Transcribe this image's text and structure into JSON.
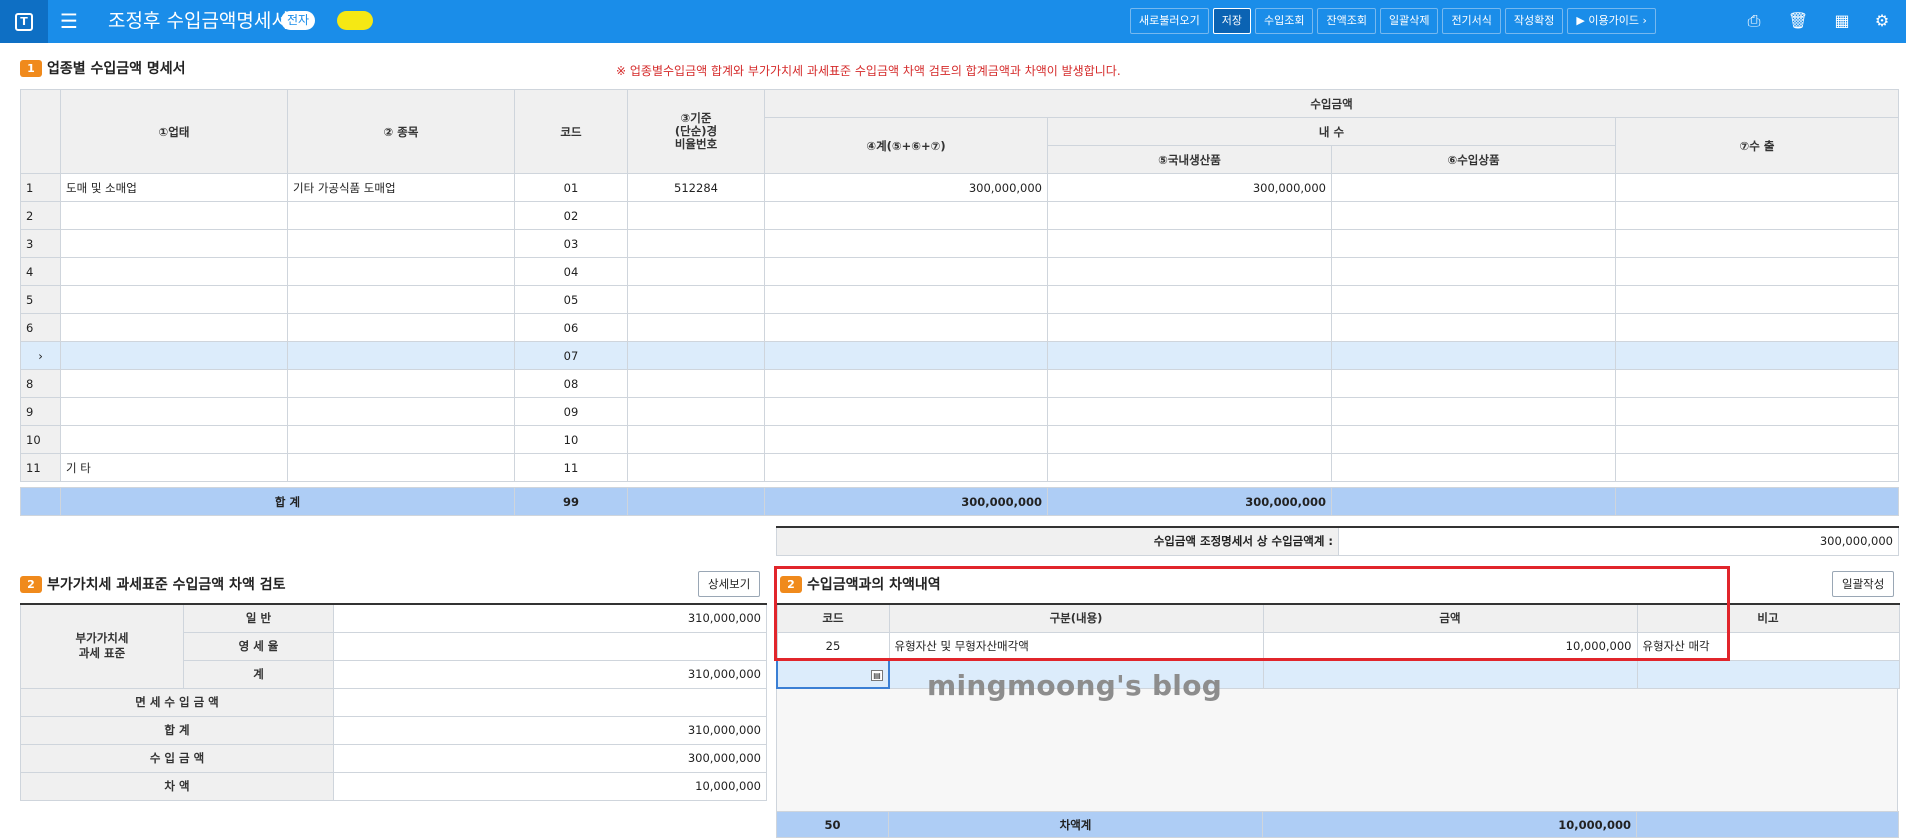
{
  "header": {
    "logo": "T",
    "title": "조정후 수입금액명세서",
    "badge": "전자",
    "buttons": [
      "새로불러오기",
      "저장",
      "수입조회",
      "잔액조회",
      "일괄삭제",
      "전기서식",
      "작성확정",
      "이용가이드 ›"
    ],
    "icons": [
      "menu-icon",
      "printer-icon",
      "trash-icon",
      "calculator-icon",
      "settings-icon"
    ]
  },
  "section1": {
    "num": "1",
    "title": "업종별 수입금액 명세서",
    "warning": "※ 업종별수입금액 합계와 부가가치세 과세표준 수입금액 차액 검토의 합계금액과 차액이 발생합니다.",
    "headers": {
      "upte": "①업태",
      "jongmok": "② 종목",
      "code": "코드",
      "rate1": "③기준",
      "rate2": "(단순)경",
      "rate3": "비율번호",
      "income": "수입금액",
      "gye": "④계(⑤+⑥+⑦)",
      "domestic": "내 수",
      "prod": "⑤국내생산품",
      "imp": "⑥수입상품",
      "export": "⑦수 출"
    },
    "rows": [
      {
        "no": "1",
        "upte": "도매 및 소매업",
        "jongmok": "기타 가공식품 도매업",
        "code": "01",
        "rate": "512284",
        "gye": "300,000,000",
        "prod": "300,000,000",
        "imp": "",
        "export": ""
      },
      {
        "no": "2",
        "upte": "",
        "jongmok": "",
        "code": "02",
        "rate": "",
        "gye": "",
        "prod": "",
        "imp": "",
        "export": ""
      },
      {
        "no": "3",
        "upte": "",
        "jongmok": "",
        "code": "03",
        "rate": "",
        "gye": "",
        "prod": "",
        "imp": "",
        "export": ""
      },
      {
        "no": "4",
        "upte": "",
        "jongmok": "",
        "code": "04",
        "rate": "",
        "gye": "",
        "prod": "",
        "imp": "",
        "export": ""
      },
      {
        "no": "5",
        "upte": "",
        "jongmok": "",
        "code": "05",
        "rate": "",
        "gye": "",
        "prod": "",
        "imp": "",
        "export": ""
      },
      {
        "no": "6",
        "upte": "",
        "jongmok": "",
        "code": "06",
        "rate": "",
        "gye": "",
        "prod": "",
        "imp": "",
        "export": ""
      },
      {
        "no": "›",
        "upte": "",
        "jongmok": "",
        "code": "07",
        "rate": "",
        "gye": "",
        "prod": "",
        "imp": "",
        "export": ""
      },
      {
        "no": "8",
        "upte": "",
        "jongmok": "",
        "code": "08",
        "rate": "",
        "gye": "",
        "prod": "",
        "imp": "",
        "export": ""
      },
      {
        "no": "9",
        "upte": "",
        "jongmok": "",
        "code": "09",
        "rate": "",
        "gye": "",
        "prod": "",
        "imp": "",
        "export": ""
      },
      {
        "no": "10",
        "upte": "",
        "jongmok": "",
        "code": "10",
        "rate": "",
        "gye": "",
        "prod": "",
        "imp": "",
        "export": ""
      },
      {
        "no": "11",
        "upte": "기  타",
        "jongmok": "",
        "code": "11",
        "rate": "",
        "gye": "",
        "prod": "",
        "imp": "",
        "export": ""
      }
    ],
    "sum": {
      "label": "합      계",
      "code": "99",
      "gye": "300,000,000",
      "prod": "300,000,000"
    },
    "adjust": {
      "label": "수입금액 조정명세서 상 수입금액계 :",
      "value": "300,000,000"
    }
  },
  "section2a": {
    "num": "2",
    "title": "부가가치세 과세표준 수입금액 차액 검토",
    "detail_button": "상세보기",
    "group_label1": "부가가치세",
    "group_label2": "과세 표준",
    "rows": [
      {
        "label": "일  반",
        "value": "310,000,000"
      },
      {
        "label": "영 세 율",
        "value": ""
      },
      {
        "label": "계",
        "value": "310,000,000"
      },
      {
        "label": "면 세 수 입 금 액",
        "value": ""
      },
      {
        "label": "합  계",
        "value": "310,000,000"
      },
      {
        "label": "수 입 금 액",
        "value": "300,000,000"
      },
      {
        "label": "차  액",
        "value": "10,000,000"
      }
    ]
  },
  "section2b": {
    "num": "2",
    "title": "수입금액과의 차액내역",
    "batch_button": "일괄작성",
    "headers": {
      "code": "코드",
      "desc": "구분(내용)",
      "amount": "금액",
      "note": "비고"
    },
    "rows": [
      {
        "code": "25",
        "desc": "유형자산 및 무형자산매각액",
        "amount": "10,000,000",
        "note": "유형자산 매각"
      }
    ],
    "sum": {
      "code": "50",
      "label": "차액계",
      "amount": "10,000,000"
    }
  },
  "watermark": "mingmoong's blog",
  "colors": {
    "topbar": "#1a8de9",
    "accent": "#f08a1c",
    "highlight": "#e1252b",
    "sum_row": "#aecdf5"
  }
}
